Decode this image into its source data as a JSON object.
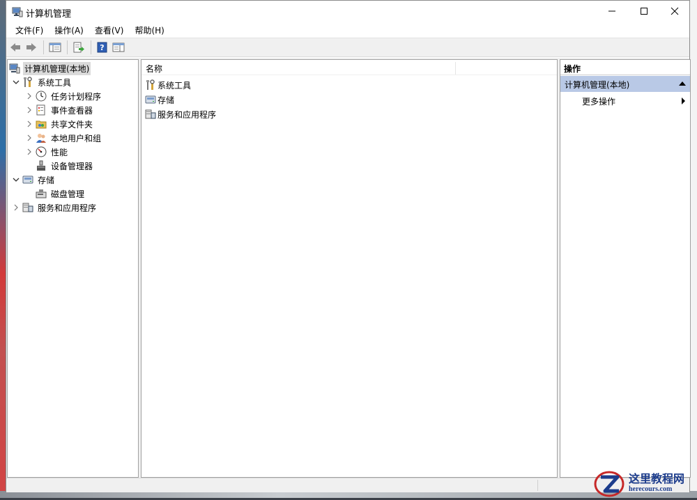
{
  "window": {
    "title": "计算机管理",
    "controls": {
      "minimize": "—",
      "maximize": "☐",
      "close": "✕"
    }
  },
  "menu": {
    "items": [
      {
        "label": "文件(F)"
      },
      {
        "label": "操作(A)"
      },
      {
        "label": "查看(V)"
      },
      {
        "label": "帮助(H)"
      }
    ]
  },
  "toolbar": {
    "buttons": [
      "back-icon",
      "forward-icon",
      "show-hide-tree-icon",
      "export-list-icon",
      "help-icon",
      "show-hide-action-pane-icon"
    ]
  },
  "tree": {
    "items": [
      {
        "label": "计算机管理(本地)",
        "icon": "computer-management-icon",
        "expander": "",
        "level": 0,
        "selected": true
      },
      {
        "label": "系统工具",
        "icon": "system-tools-icon",
        "expander": "expanded",
        "level": 1
      },
      {
        "label": "任务计划程序",
        "icon": "task-scheduler-icon",
        "expander": "collapsed",
        "level": 2
      },
      {
        "label": "事件查看器",
        "icon": "event-viewer-icon",
        "expander": "collapsed",
        "level": 2
      },
      {
        "label": "共享文件夹",
        "icon": "shared-folders-icon",
        "expander": "collapsed",
        "level": 2
      },
      {
        "label": "本地用户和组",
        "icon": "local-users-groups-icon",
        "expander": "collapsed",
        "level": 2
      },
      {
        "label": "性能",
        "icon": "performance-icon",
        "expander": "collapsed",
        "level": 2
      },
      {
        "label": "设备管理器",
        "icon": "device-manager-icon",
        "expander": "",
        "level": 2
      },
      {
        "label": "存储",
        "icon": "storage-icon",
        "expander": "expanded",
        "level": 1
      },
      {
        "label": "磁盘管理",
        "icon": "disk-management-icon",
        "expander": "",
        "level": 2
      },
      {
        "label": "服务和应用程序",
        "icon": "services-applications-icon",
        "expander": "collapsed",
        "level": 1
      }
    ]
  },
  "list": {
    "column_name": "名称",
    "rows": [
      {
        "label": "系统工具",
        "icon": "system-tools-icon"
      },
      {
        "label": "存储",
        "icon": "storage-icon"
      },
      {
        "label": "服务和应用程序",
        "icon": "services-applications-icon"
      }
    ]
  },
  "actions": {
    "title": "操作",
    "section": "计算机管理(本地)",
    "items": [
      {
        "label": "更多操作"
      }
    ]
  },
  "watermark": {
    "cn": "这里教程网",
    "en": "herecours.com"
  },
  "colors": {
    "selection": "#dadada",
    "action_section": "#b9c9e6",
    "toolbar_bg": "#f0f0f0",
    "watermark_blue": "#1c3c8c",
    "watermark_red": "#c62828"
  }
}
